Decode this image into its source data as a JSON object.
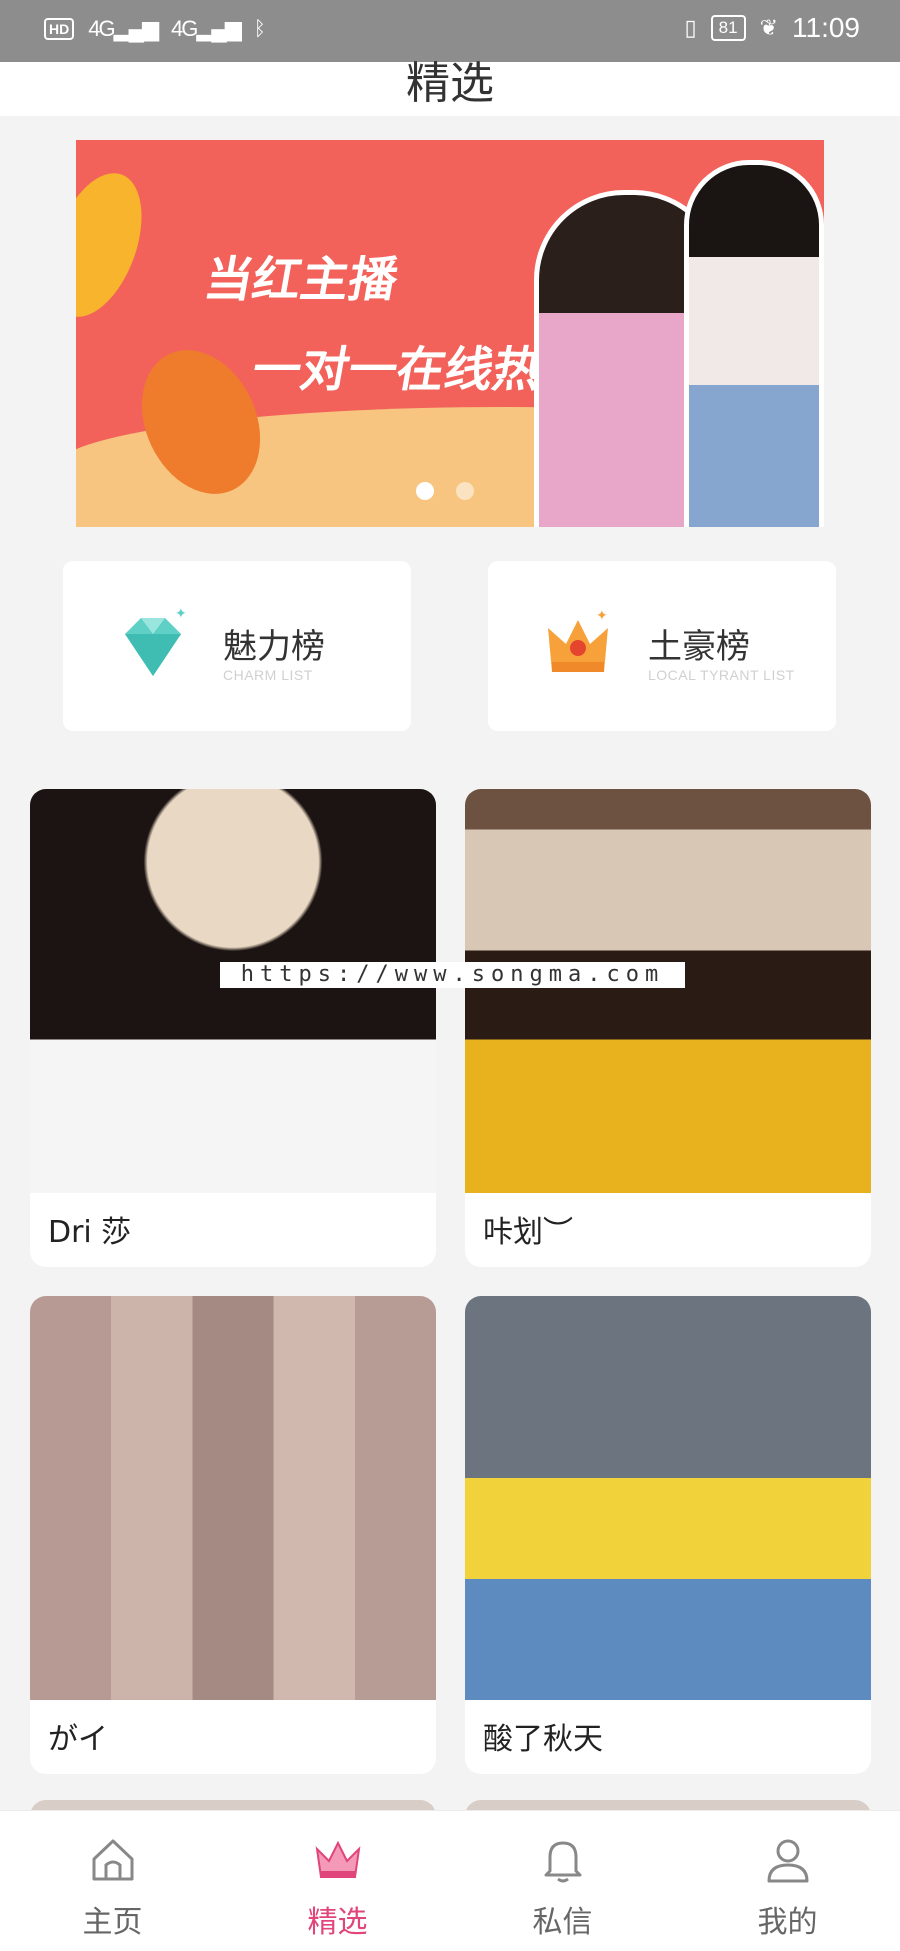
{
  "status_bar": {
    "left": [
      "HD",
      "4G",
      "4G",
      "bluetooth-icon"
    ],
    "battery": "81",
    "time": "11:09"
  },
  "header": {
    "title": "精选"
  },
  "banner": {
    "line1": "当红主播",
    "line2": "一对一在线热聊",
    "active_dot": 1,
    "dot_count": 2
  },
  "rankings": [
    {
      "title": "魅力榜",
      "subtitle": "CHARM LIST",
      "icon": "diamond-icon"
    },
    {
      "title": "土豪榜",
      "subtitle": "LOCAL TYRANT LIST",
      "icon": "crown-icon"
    }
  ],
  "watermark": "https://www.songma.com",
  "cards": [
    {
      "name": "Dri 莎"
    },
    {
      "name": "咔划︶"
    },
    {
      "name": "がイ"
    },
    {
      "name": "酸了秋天"
    }
  ],
  "tabs": [
    {
      "label": "主页",
      "icon": "home-icon",
      "active": false
    },
    {
      "label": "精选",
      "icon": "crown-icon",
      "active": true
    },
    {
      "label": "私信",
      "icon": "bell-icon",
      "active": false
    },
    {
      "label": "我的",
      "icon": "user-icon",
      "active": false
    }
  ],
  "colors": {
    "accent": "#e0457b",
    "statusbar": "#8d8d8d",
    "banner_bg": "#f2625a"
  }
}
